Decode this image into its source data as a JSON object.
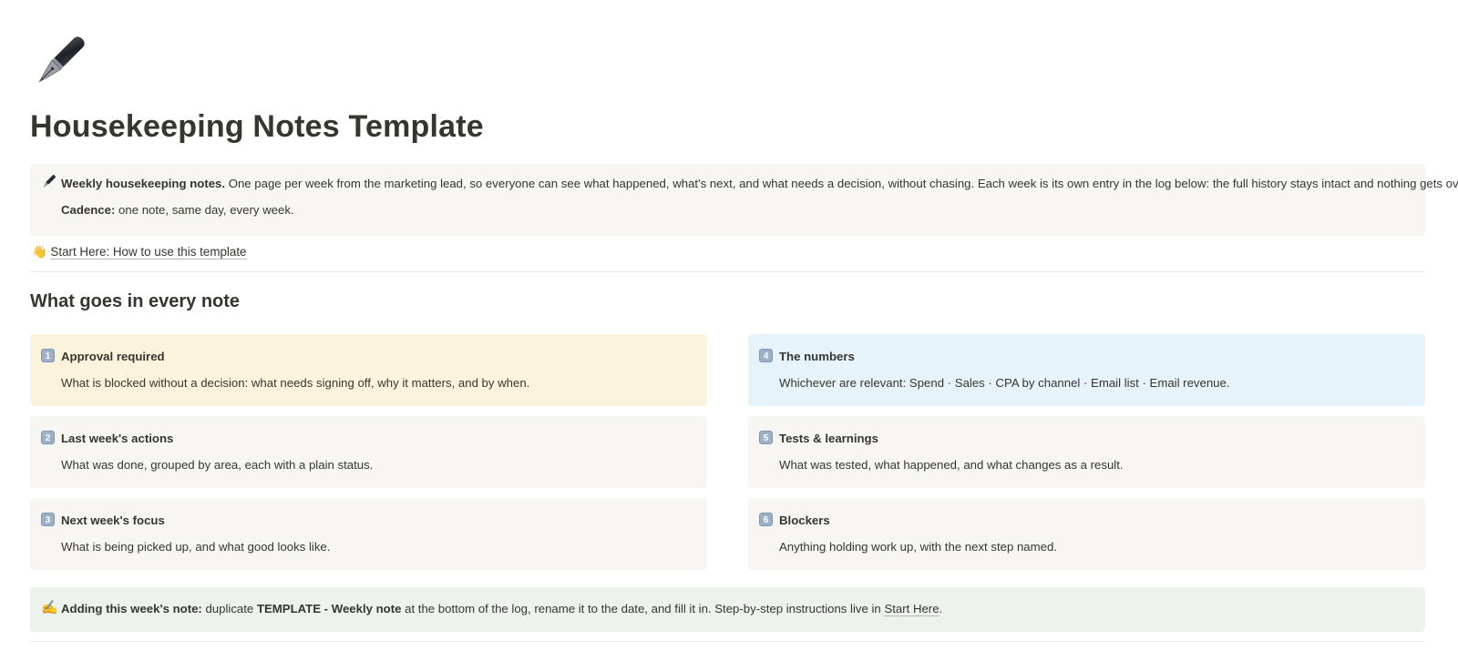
{
  "page": {
    "icon": "fountain-pen-icon",
    "title": "Housekeeping Notes Template"
  },
  "intro_callout": {
    "icon": "pen-icon",
    "line1_bold": "Weekly housekeeping notes.",
    "line1_text": " One page per week from the marketing lead, so everyone can see what happened, what's next, and what needs a decision, without chasing. Each week is its own entry in the log below: the full history stays intact and nothing gets overwritten.",
    "line2_bold": "Cadence:",
    "line2_text": " one note, same day, every week."
  },
  "start_link": {
    "icon": "waving-hand-icon",
    "label": "Start Here: How to use this template"
  },
  "section_heading": "What goes in every note",
  "cards": [
    {
      "num": "1",
      "title": "Approval required",
      "desc": "What is blocked without a decision: what needs signing off, why it matters, and by when.",
      "color": "#fbf3db"
    },
    {
      "num": "4",
      "title": "The numbers",
      "desc": "Whichever are relevant: Spend · Sales · CPA by channel · Email list · Email revenue.",
      "color": "#e7f3fb"
    },
    {
      "num": "2",
      "title": "Last week's actions",
      "desc": "What was done, grouped by area, each with a plain status.",
      "color": "#f7f6f3"
    },
    {
      "num": "5",
      "title": "Tests & learnings",
      "desc": "What was tested, what happened, and what changes as a result.",
      "color": "#f7f6f3"
    },
    {
      "num": "3",
      "title": "Next week's focus",
      "desc": "What is being picked up, and what good looks like.",
      "color": "#f7f6f3"
    },
    {
      "num": "6",
      "title": "Blockers",
      "desc": "Anything holding work up, with the next step named.",
      "color": "#f7f6f3"
    }
  ],
  "footer_callout": {
    "icon": "writing-hand-icon",
    "bold_prefix": "Adding this week's note:",
    "text1": " duplicate ",
    "code": "TEMPLATE - Weekly note",
    "text2": " at the bottom of the log, rename it to the date, and fill it in. Step-by-step instructions live in ",
    "link": "Start Here",
    "text3": "."
  }
}
